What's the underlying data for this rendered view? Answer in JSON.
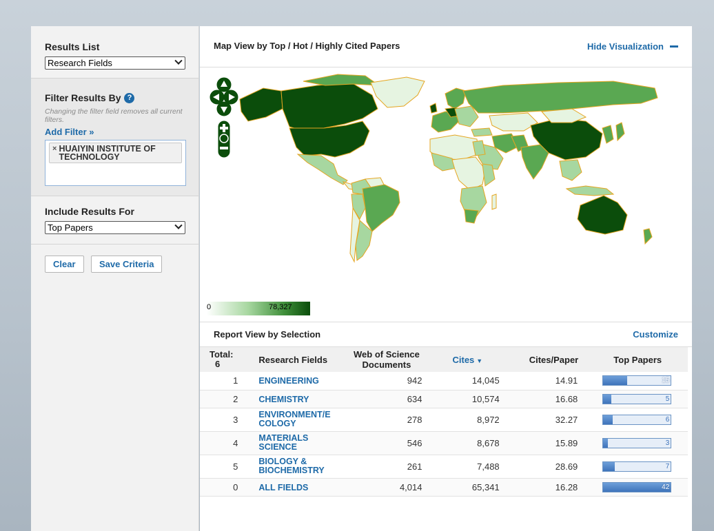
{
  "left_panel": {
    "results_list_label": "Results List",
    "results_list_value": "Research Fields",
    "filter_label": "Filter Results By",
    "help": "?",
    "filter_hint": "Changing the filter field removes all current filters.",
    "add_filter": "Add Filter »",
    "filter_chip": "HUAIYIN INSTITUTE OF TECHNOLOGY",
    "chip_remove": "×",
    "include_label": "Include Results For",
    "include_value": "Top Papers",
    "clear_button": "Clear",
    "save_button": "Save Criteria"
  },
  "map_panel": {
    "title": "Map View by Top / Hot / Highly Cited Papers",
    "hide_label": "Hide Visualization",
    "legend_min": "0",
    "legend_max": "78,327",
    "colors": {
      "dark": "#0b4d0b",
      "mid": "#5aa852",
      "light": "#a7d7a0",
      "pale": "#e6f4e1",
      "border": "#e5a520"
    }
  },
  "report": {
    "title": "Report View by Selection",
    "customize": "Customize",
    "headers": {
      "total": "Total:",
      "total_count": "6",
      "field": "Research Fields",
      "docs": "Web of Science Documents",
      "cites": "Cites",
      "sort": "▼",
      "cpp": "Cites/Paper",
      "top": "Top Papers"
    },
    "rows": [
      {
        "rank": "1",
        "field": "ENGINEERING",
        "docs": "942",
        "cites": "14,045",
        "cpp": "14.91",
        "top": "15",
        "top_fraction": 0.357
      },
      {
        "rank": "2",
        "field": "CHEMISTRY",
        "docs": "634",
        "cites": "10,574",
        "cpp": "16.68",
        "top": "5",
        "top_fraction": 0.119
      },
      {
        "rank": "3",
        "field": "ENVIRONMENT/E COLOGY",
        "docs": "278",
        "cites": "8,972",
        "cpp": "32.27",
        "top": "6",
        "top_fraction": 0.143
      },
      {
        "rank": "4",
        "field": "MATERIALS SCIENCE",
        "docs": "546",
        "cites": "8,678",
        "cpp": "15.89",
        "top": "3",
        "top_fraction": 0.071
      },
      {
        "rank": "5",
        "field": "BIOLOGY & BIOCHEMISTRY",
        "docs": "261",
        "cites": "7,488",
        "cpp": "28.69",
        "top": "7",
        "top_fraction": 0.167
      },
      {
        "rank": "0",
        "field": "ALL FIELDS",
        "docs": "4,014",
        "cites": "65,341",
        "cpp": "16.28",
        "top": "42",
        "top_fraction": 1.0
      }
    ]
  }
}
